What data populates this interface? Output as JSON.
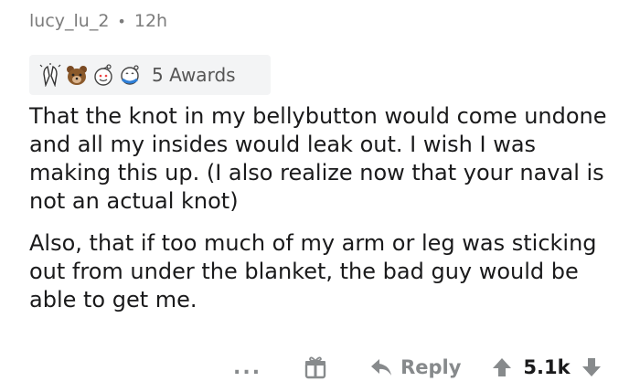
{
  "header": {
    "username": "lucy_lu_2",
    "separator": "•",
    "timestamp": "12h"
  },
  "awards": {
    "icons": [
      "praying-hands-icon",
      "bear-icon",
      "wholesome-face-icon",
      "hugz-face-icon"
    ],
    "label": "5 Awards"
  },
  "comment": {
    "paragraph1": "That the knot in my bellybutton would come undone and all my insides would leak out. I wish I was making this up. (I also realize now that your naval is not an actual knot)",
    "paragraph2": "Also, that if too much of my arm or leg was sticking out from under the blanket, the bad guy would be able to get me."
  },
  "actions": {
    "more_label": "...",
    "reply_label": "Reply",
    "score": "5.1k"
  },
  "colors": {
    "meta": "#7c7c7c",
    "action": "#878a8c",
    "award_bg": "#f3f4f5",
    "text": "#1a1a1b"
  }
}
